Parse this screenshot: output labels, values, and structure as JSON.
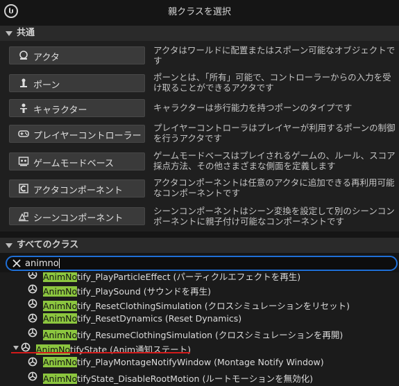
{
  "window": {
    "title": "親クラスを選択"
  },
  "common": {
    "header": "共通",
    "items": [
      {
        "label": "アクタ",
        "icon": "actor-icon",
        "desc": "アクタはワールドに配置またはスポーン可能なオブジェクトです"
      },
      {
        "label": "ポーン",
        "icon": "pawn-icon",
        "desc": "ポーンとは、「所有」可能で、コントローラーからの入力を受け取ることができるアクタです"
      },
      {
        "label": "キャラクター",
        "icon": "character-icon",
        "desc": "キャラクターは歩行能力を持つポーンのタイプです"
      },
      {
        "label": "プレイヤーコントローラー",
        "icon": "gamepad-icon",
        "desc": "プレイヤーコントローラはプレイヤーが利用するポーンの制御を行うアクタです"
      },
      {
        "label": "ゲームモードベース",
        "icon": "game-mode-icon",
        "desc": "ゲームモードベースはプレイされるゲームの、ルール、スコア採点方法、その他さまざまな側面を定義します"
      },
      {
        "label": "アクタコンポーネント",
        "icon": "actor-component-icon",
        "desc": "アクタコンポーネントは任意のアクタに追加できる再利用可能なコンポーネントです"
      },
      {
        "label": "シーンコンポーネント",
        "icon": "scene-component-icon",
        "desc": "シーンコンポーネントはシーン変換を設定して別のシーンコンポーネントに親子付け可能なコンポーネントです"
      }
    ]
  },
  "all_classes": {
    "header": "すべてのクラス",
    "search_value": "animno",
    "results": [
      {
        "match": "AnimNo",
        "rest": "tify_PlayParticleEffect (パーティクルエフェクトを再生)",
        "expandable": false
      },
      {
        "match": "AnimNo",
        "rest": "tify_PlaySound (サウンドを再生)",
        "expandable": false
      },
      {
        "match": "AnimNo",
        "rest": "tify_ResetClothingSimulation (クロスシミュレーションをリセット)",
        "expandable": false
      },
      {
        "match": "AnimNo",
        "rest": "tify_ResetDynamics (Reset Dynamics)",
        "expandable": false
      },
      {
        "match": "AnimNo",
        "rest": "tify_ResumeClothingSimulation (クロスシミュレーションを再開)",
        "expandable": false
      },
      {
        "match": "AnimNo",
        "rest": "tifyState (Anim通知ステート)",
        "expandable": true
      },
      {
        "match": "AnimNo",
        "rest": "tify_PlayMontageNotifyWindow (Montage Notify Window)",
        "expandable": false
      },
      {
        "match": "AnimNo",
        "rest": "tifyState_DisableRootMotion (ルートモーションを無効化)",
        "expandable": false
      }
    ]
  },
  "colors": {
    "highlight": "#8cc63f",
    "search_border": "#1f6fd6",
    "annotation": "#d41a1a"
  }
}
